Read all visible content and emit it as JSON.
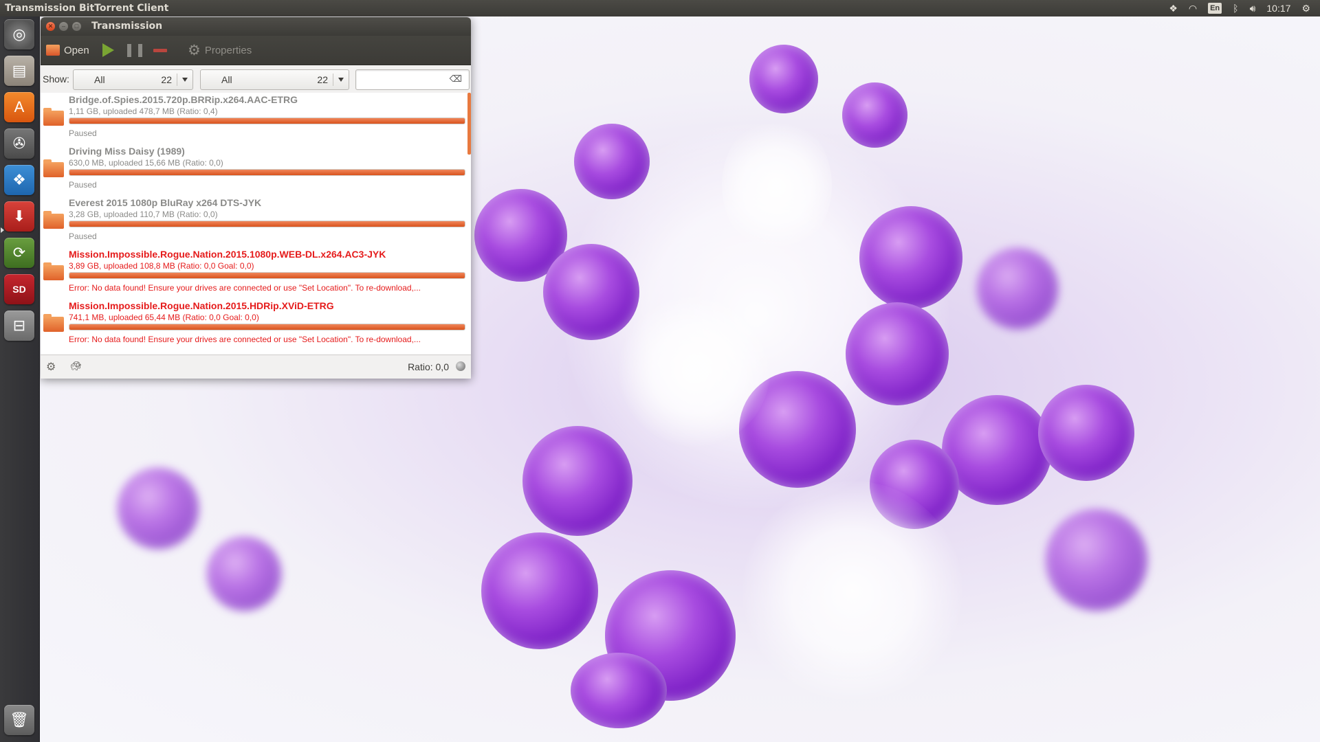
{
  "top_panel": {
    "app_title": "Transmission BitTorrent Client",
    "keyboard_layout": "En",
    "clock": "10:17"
  },
  "window": {
    "title": "Transmission",
    "toolbar": {
      "open_label": "Open",
      "properties_label": "Properties"
    },
    "filter": {
      "show_label": "Show:",
      "activity_value": "All",
      "activity_count": "22",
      "tracker_value": "All",
      "tracker_count": "22",
      "search_value": ""
    },
    "torrents": [
      {
        "name": "Bridge.of.Spies.2015.720p.BRRip.x264.AAC-ETRG",
        "info": "1,11 GB, uploaded 478,7 MB (Ratio: 0,4)",
        "status": "Paused",
        "progress": 1.0,
        "error": false
      },
      {
        "name": "Driving Miss Daisy (1989)",
        "info": "630,0 MB, uploaded 15,66 MB (Ratio: 0,0)",
        "status": "Paused",
        "progress": 1.0,
        "error": false
      },
      {
        "name": "Everest 2015 1080p BluRay x264 DTS-JYK",
        "info": "3,28 GB, uploaded 110,7 MB (Ratio: 0,0)",
        "status": "Paused",
        "progress": 1.0,
        "error": false
      },
      {
        "name": "Mission.Impossible.Rogue.Nation.2015.1080p.WEB-DL.x264.AC3-JYK",
        "info": "3,89 GB, uploaded 108,8 MB (Ratio: 0,0 Goal: 0,0)",
        "status": "Error: No data found! Ensure your drives are connected or use \"Set Location\". To re-download,...",
        "progress": 1.0,
        "error": true
      },
      {
        "name": "Mission.Impossible.Rogue.Nation.2015.HDRip.XViD-ETRG",
        "info": "741,1 MB, uploaded 65,44 MB (Ratio: 0,0 Goal: 0,0)",
        "status": "Error: No data found! Ensure your drives are connected or use \"Set Location\". To re-download,...",
        "progress": 1.0,
        "error": true
      }
    ],
    "statusbar": {
      "ratio_text": "Ratio: 0,0"
    }
  },
  "launcher": {
    "items": [
      "ubuntu-dash-icon",
      "files-icon",
      "software-center-icon",
      "system-settings-icon",
      "dropbox-icon",
      "transmission-icon",
      "software-updater-icon",
      "sd-card-icon",
      "usb-drive-icon",
      "trash-icon"
    ]
  },
  "colors": {
    "accent_orange": "#e8793f",
    "error_red": "#e51b1b",
    "panel": "#3c3b37"
  }
}
